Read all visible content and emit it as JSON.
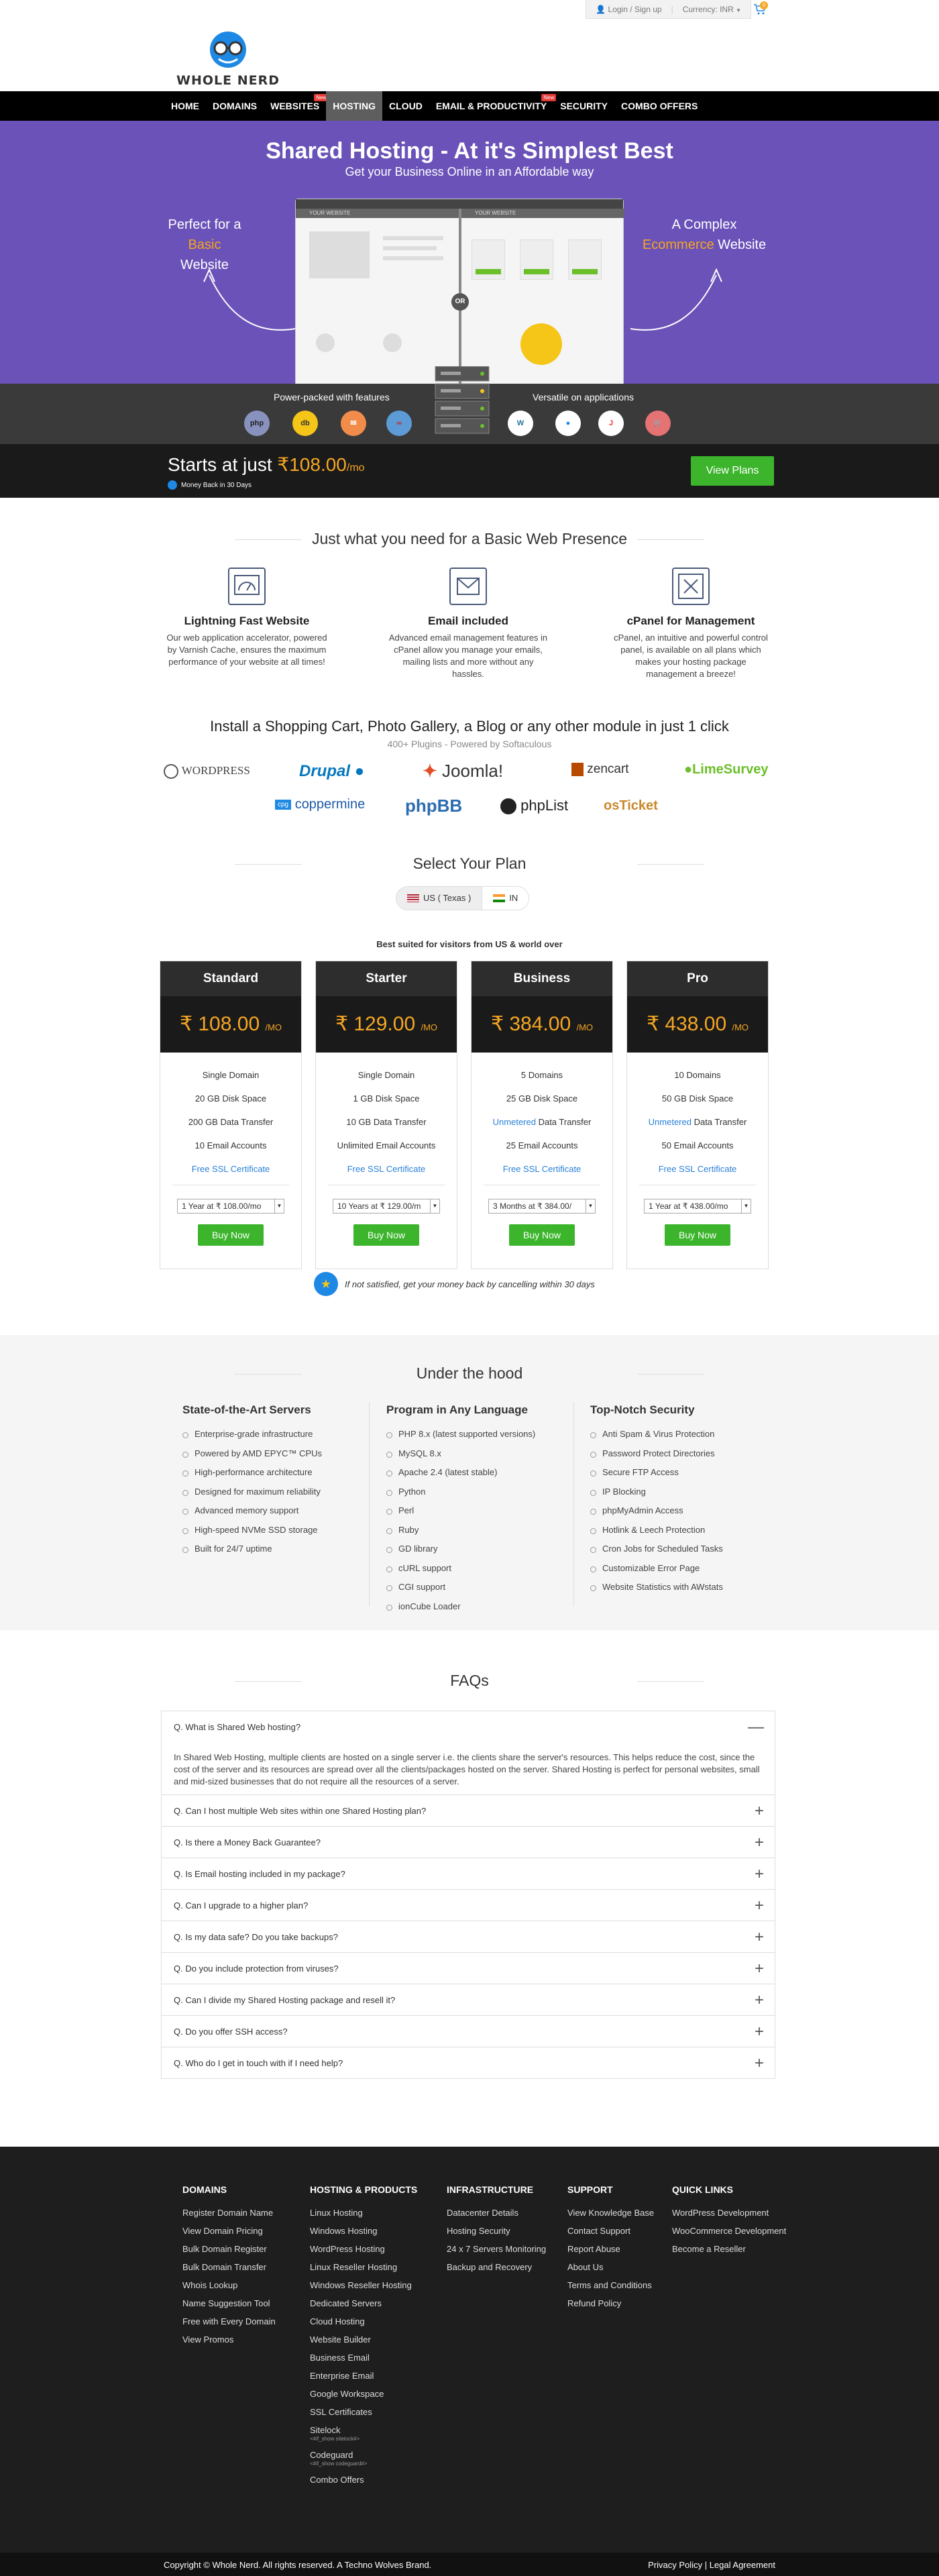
{
  "topbar": {
    "login": "Login / Sign up",
    "currency_label": "Currency:",
    "currency": "INR",
    "cart_count": "0"
  },
  "logo": {
    "text": "WHOLE NERD"
  },
  "nav": {
    "items": [
      {
        "label": "HOME"
      },
      {
        "label": "DOMAINS"
      },
      {
        "label": "WEBSITES",
        "badge": "New"
      },
      {
        "label": "HOSTING",
        "active": true
      },
      {
        "label": "CLOUD"
      },
      {
        "label": "EMAIL & PRODUCTIVITY",
        "badge": "New"
      },
      {
        "label": "SECURITY"
      },
      {
        "label": "COMBO OFFERS"
      }
    ]
  },
  "hero": {
    "title": "Shared Hosting - At it's Simplest Best",
    "subtitle": "Get your Business Online in an Affordable way",
    "left_pre": "Perfect for a ",
    "left_hl": "Basic",
    "left_post": "Website",
    "right_pre": "A Complex",
    "right_hl": "Ecommerce",
    "right_post": " Website",
    "mock_tab_left": "YOUR WEBSITE",
    "mock_tab_right": "YOUR WEBSITE",
    "or": "OR"
  },
  "strip": {
    "left_label": "Power-packed with features",
    "right_label": "Versatile on applications"
  },
  "starts": {
    "prefix": "Starts at just ",
    "currency": "₹",
    "price": "108.00",
    "unit": "/mo",
    "money_back": "Money Back in 30 Days",
    "cta": "View Plans"
  },
  "basic": {
    "title": "Just what you need for a Basic Web Presence",
    "features": [
      {
        "title": "Lightning Fast Website",
        "text": "Our web application accelerator, powered by Varnish Cache, ensures the maximum performance of your website at all times!"
      },
      {
        "title": "Email included",
        "text": "Advanced email management features in cPanel allow you manage your emails, mailing lists and more without any hassles."
      },
      {
        "title": "cPanel for Management",
        "text": "cPanel, an intuitive and powerful control panel, is available on all plans which makes your hosting package management a breeze!"
      }
    ]
  },
  "softaculous": {
    "title": "Install a Shopping Cart, Photo Gallery, a Blog or any other module in just 1 click",
    "subtitle": "400+ Plugins - Powered by Softaculous",
    "logos_row1": [
      "WORDPRESS",
      "Drupal",
      "Joomla!",
      "zencart",
      "LimeSurvey"
    ],
    "logos_row2": [
      "coppermine",
      "phpBB",
      "phpList",
      "osTicket"
    ]
  },
  "plans_section": {
    "title": "Select Your Plan",
    "loc_us": "US ( Texas )",
    "loc_in": "IN",
    "best_suited": "Best suited for visitors from US & world over",
    "guarantee": "If not satisfied, get your money back by cancelling within 30 days",
    "plans": [
      {
        "name": "Standard",
        "price": "108.00",
        "features": [
          "Single Domain",
          "20 GB Disk Space",
          "200 GB Data Transfer",
          "10 Email Accounts"
        ],
        "ssl": "Free SSL Certificate",
        "term": "1 Year at ₹ 108.00/mo",
        "buy": "Buy Now"
      },
      {
        "name": "Starter",
        "price": "129.00",
        "features": [
          "Single Domain",
          "1 GB Disk Space",
          "10 GB Data Transfer",
          "Unlimited Email Accounts"
        ],
        "ssl": "Free SSL Certificate",
        "term": "10 Years at ₹ 129.00/m",
        "buy": "Buy Now"
      },
      {
        "name": "Business",
        "price": "384.00",
        "features": [
          "5 Domains",
          "25 GB Disk Space",
          "Unmetered|Data Transfer",
          "25 Email Accounts"
        ],
        "ssl": "Free SSL Certificate",
        "term": "3 Months at ₹ 384.00/",
        "buy": "Buy Now"
      },
      {
        "name": "Pro",
        "price": "438.00",
        "features": [
          "10 Domains",
          "50 GB Disk Space",
          "Unmetered|Data Transfer",
          "50 Email Accounts"
        ],
        "ssl": "Free SSL Certificate",
        "term": "1 Year at ₹ 438.00/mo",
        "buy": "Buy Now"
      }
    ],
    "currency": "₹",
    "unit": "/MO"
  },
  "hood": {
    "title": "Under the hood",
    "cols": [
      {
        "title": "State-of-the-Art Servers",
        "items": [
          "Enterprise-grade infrastructure",
          "Powered by AMD EPYC™ CPUs",
          "High-performance architecture",
          "Designed for maximum reliability",
          "Advanced memory support",
          "High-speed NVMe SSD storage",
          "Built for 24/7 uptime"
        ]
      },
      {
        "title": "Program in Any Language",
        "items": [
          "PHP 8.x (latest supported versions)",
          "MySQL 8.x",
          "Apache 2.4 (latest stable)",
          "Python",
          "Perl",
          "Ruby",
          "GD library",
          "cURL support",
          "CGI support",
          "ionCube Loader"
        ]
      },
      {
        "title": "Top-Notch Security",
        "items": [
          "Anti Spam & Virus Protection",
          "Password Protect Directories",
          "Secure FTP Access",
          "IP Blocking",
          "phpMyAdmin Access",
          "Hotlink & Leech Protection",
          "Cron Jobs for Scheduled Tasks",
          "Customizable Error Page",
          "Website Statistics with AWstats"
        ]
      }
    ]
  },
  "faq": {
    "title": "FAQs",
    "open_q": "Q. What is Shared Web hosting?",
    "open_a": "In Shared Web Hosting, multiple clients are hosted on a single server i.e. the clients share the server's resources. This helps reduce the cost, since the cost of the server and its resources are spread over all the clients/packages hosted on the server. Shared Hosting is perfect for personal websites, small and mid-sized businesses that do not require all the resources of a server.",
    "items": [
      "Q. Can I host multiple Web sites within one Shared Hosting plan?",
      "Q. Is there a Money Back Guarantee?",
      "Q. Is Email hosting included in my package?",
      "Q. Can I upgrade to a higher plan?",
      "Q. Is my data safe? Do you take backups?",
      "Q. Do you include protection from viruses?",
      "Q. Can I divide my Shared Hosting package and resell it?",
      "Q. Do you offer SSH access?",
      "Q. Who do I get in touch with if I need help?"
    ]
  },
  "footer": {
    "cols": [
      {
        "title": "DOMAINS",
        "items": [
          "Register Domain Name",
          "View Domain Pricing",
          "Bulk Domain Register",
          "Bulk Domain Transfer",
          "Whois Lookup",
          "Name Suggestion Tool",
          "Free with Every Domain",
          "View Promos"
        ]
      },
      {
        "title": "HOSTING & PRODUCTS",
        "items": [
          "Linux Hosting",
          "Windows Hosting",
          "WordPress Hosting",
          "Linux Reseller Hosting",
          "Windows Reseller Hosting",
          "Dedicated Servers",
          "Cloud Hosting",
          "Website Builder",
          "Business Email",
          "Enterprise Email",
          "Google Workspace",
          "SSL Certificates"
        ]
      },
      {
        "title": "INFRASTRUCTURE",
        "items": [
          "Datacenter Details",
          "Hosting Security",
          "24 x 7 Servers Monitoring",
          "Backup and Recovery"
        ]
      },
      {
        "title": "SUPPORT",
        "items": [
          "View Knowledge Base",
          "Contact Support",
          "Report Abuse",
          "About Us",
          "Terms and Conditions",
          "Refund Policy"
        ]
      },
      {
        "title": "QUICK LINKS",
        "items": [
          "WordPress Development",
          "WooCommerce Development",
          "Become a Reseller"
        ]
      }
    ],
    "sitelock": "Sitelock",
    "sitelock_small": "<#if_show sitelock#>",
    "codeguard": "Codeguard",
    "codeguard_small": "<#if_show codeguard#>",
    "combo": "Combo Offers",
    "copyright": "Copyright © Whole Nerd. All rights reserved. A Techno Wolves Brand.",
    "privacy": "Privacy Policy",
    "legal": "Legal Agreement"
  }
}
